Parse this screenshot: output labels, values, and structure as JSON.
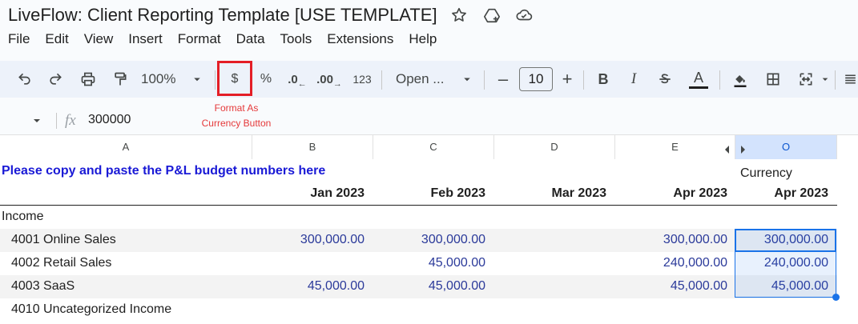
{
  "doc": {
    "title": "LiveFlow: Client Reporting Template [USE TEMPLATE]"
  },
  "menu": [
    "File",
    "Edit",
    "View",
    "Insert",
    "Format",
    "Data",
    "Tools",
    "Extensions",
    "Help"
  ],
  "toolbar": {
    "zoom": "100%",
    "currency": "$",
    "percent": "%",
    "dec_decrease": ".0",
    "dec_increase": ".00",
    "number_format": "123",
    "font": "Open ...",
    "font_size": "10",
    "bold": "B",
    "italic": "I",
    "text_color": "A"
  },
  "annotation": {
    "line1": "Format As",
    "line2": "Currency Button"
  },
  "formula_bar": {
    "fx": "fx",
    "value": "300000"
  },
  "columns": [
    "A",
    "B",
    "C",
    "D",
    "E",
    "O"
  ],
  "sheet": {
    "instruction": "Please copy and paste the P&L budget numbers here",
    "currency_label": "Currency",
    "months": [
      "Jan 2023",
      "Feb 2023",
      "Mar 2023",
      "Apr 2023",
      "Apr 2023"
    ],
    "section": "Income",
    "rows": [
      {
        "label": "4001 Online Sales",
        "b": "300,000.00",
        "c": "300,000.00",
        "d": "",
        "e": "300,000.00",
        "o": "300,000.00"
      },
      {
        "label": "4002 Retail Sales",
        "b": "",
        "c": "45,000.00",
        "d": "",
        "e": "240,000.00",
        "o": "240,000.00"
      },
      {
        "label": "4003 SaaS",
        "b": "45,000.00",
        "c": "45,000.00",
        "d": "",
        "e": "45,000.00",
        "o": "45,000.00"
      },
      {
        "label": "4010 Uncategorized Income",
        "b": "",
        "c": "",
        "d": "",
        "e": "",
        "o": ""
      }
    ]
  },
  "colors": {
    "highlight": "#e41e26",
    "annotation": "#e5393a",
    "instruction": "#1a1ad6",
    "number": "#2b3a9a",
    "selection": "#1a73e8"
  }
}
